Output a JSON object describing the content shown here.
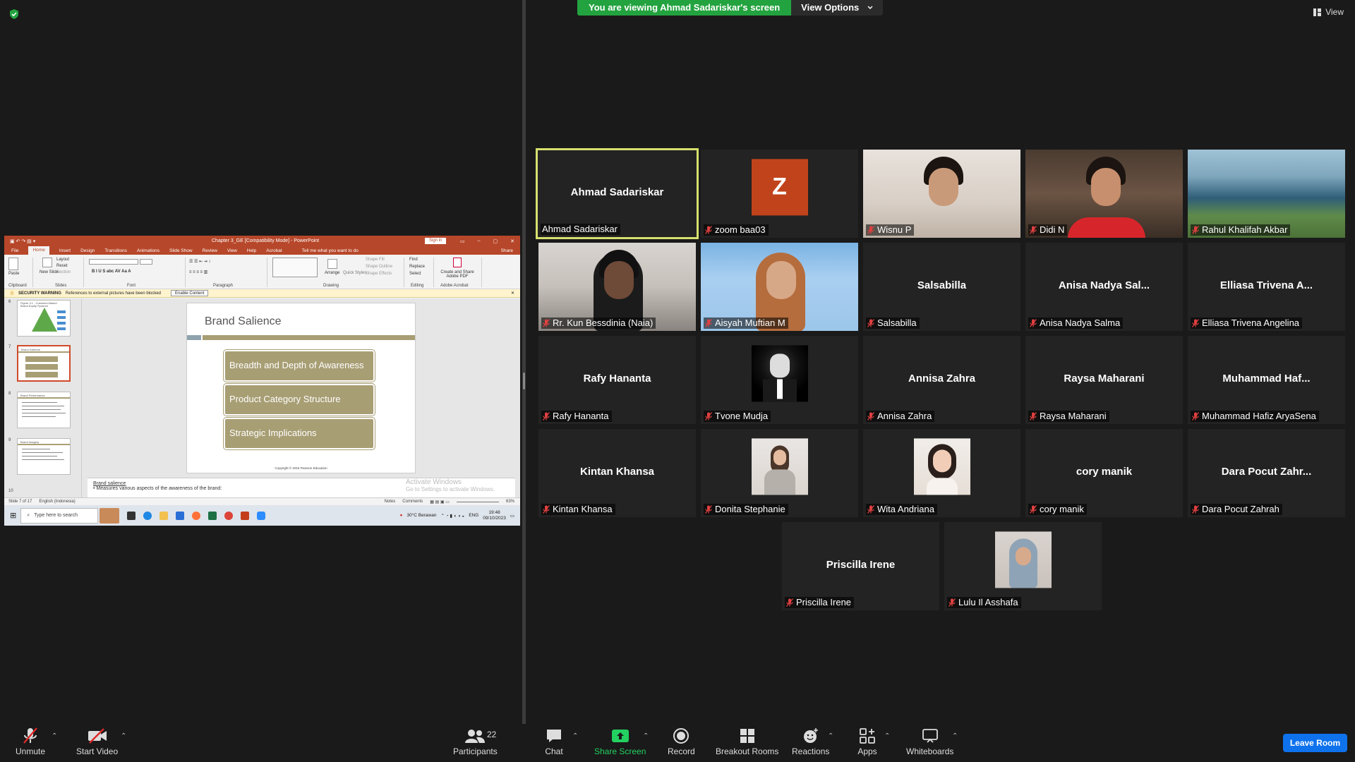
{
  "banner": {
    "viewing_text": "You are viewing Ahmad Sadariskar's screen",
    "view_options": "View Options"
  },
  "top_right": {
    "view_label": "View"
  },
  "ppt": {
    "window_title": "Chapter 3_GE [Compatibility Mode] - PowerPoint",
    "sign_in": "Sign in",
    "tabs": [
      "File",
      "Home",
      "Insert",
      "Design",
      "Transitions",
      "Animations",
      "Slide Show",
      "Review",
      "View",
      "Help",
      "Acrobat"
    ],
    "tell_me": "Tell me what you want to do",
    "share": "Share",
    "ribbon_groups": [
      "Clipboard",
      "Slides",
      "Font",
      "Paragraph",
      "Drawing",
      "Editing",
      "Adobe Acrobat"
    ],
    "ribbon_items": {
      "paste": "Paste",
      "new_slide": "New Slide",
      "layout": "Layout",
      "reset": "Reset",
      "section": "Section",
      "arrange": "Arrange",
      "quick_styles": "Quick Styles",
      "shape_fill": "Shape Fill",
      "shape_outline": "Shape Outline",
      "shape_effects": "Shape Effects",
      "find": "Find",
      "replace": "Replace",
      "select": "Select",
      "create_share": "Create and Share Adobe PDF"
    },
    "warning_title": "SECURITY WARNING",
    "warning_text": "References to external pictures have been blocked",
    "enable_content": "Enable Content",
    "thumbnails": [
      {
        "num": "6",
        "title": "Figure 3.1 - Customer-Based Brand Equity Pyramid"
      },
      {
        "num": "7",
        "title": "Brand Salience"
      },
      {
        "num": "8",
        "title": "Brand Performance"
      },
      {
        "num": "9",
        "title": "Brand Imagery"
      },
      {
        "num": "10",
        "title": ""
      }
    ],
    "slide": {
      "title": "Brand Salience",
      "boxes": [
        "Breadth and Depth of Awareness",
        "Product Category Structure",
        "Strategic Implications"
      ],
      "footer": "Copyright © 2015 Pearson Education"
    },
    "notes_title": "Brand salience",
    "notes_bullet": "Measures various aspects of the awareness of the brand:",
    "status_slide": "Slide 7 of 17",
    "status_lang": "English (Indonesia)",
    "status_notes": "Notes",
    "status_comments": "Comments",
    "status_zoom": "63%",
    "activate_title": "Activate Windows",
    "activate_sub": "Go to Settings to activate Windows.",
    "taskbar_search": "Type here to search",
    "weather": "30°C  Berawan",
    "lang": "ENG",
    "time": "19:48",
    "date": "09/10/2023"
  },
  "participants": [
    {
      "name": "Ahmad Sadariskar",
      "label": "Ahmad Sadariskar",
      "type": "name",
      "active": true,
      "muted": false
    },
    {
      "name": "Z",
      "label": "zoom baa03",
      "type": "initial",
      "active": false,
      "muted": true
    },
    {
      "name": "Wisnu P",
      "label": "Wisnu P",
      "type": "video",
      "active": false,
      "muted": true
    },
    {
      "name": "Didi N",
      "label": "Didi N",
      "type": "video",
      "active": false,
      "muted": true
    },
    {
      "name": "Rahul Khalifah Akbar",
      "label": "Rahul Khalifah Akbar",
      "type": "video",
      "active": false,
      "muted": true
    },
    {
      "name": "Rr. Kun Bessdinia (Naia)",
      "label": "Rr. Kun Bessdinia (Naia)",
      "type": "video",
      "active": false,
      "muted": true
    },
    {
      "name": "Aisyah Muftian M",
      "label": "Aisyah Muftian M",
      "type": "video",
      "active": false,
      "muted": true
    },
    {
      "name": "Salsabilla",
      "label": "Salsabilla",
      "type": "name",
      "active": false,
      "muted": true
    },
    {
      "name": "Anisa Nadya Sal...",
      "label": "Anisa Nadya Salma",
      "type": "name",
      "active": false,
      "muted": true
    },
    {
      "name": "Elliasa Trivena A...",
      "label": "Elliasa Trivena Angelina",
      "type": "name",
      "active": false,
      "muted": true
    },
    {
      "name": "Rafy Hananta",
      "label": "Rafy Hananta",
      "type": "name",
      "active": false,
      "muted": true
    },
    {
      "name": "Tvone Mudja",
      "label": "Tvone Mudja",
      "type": "avatar",
      "active": false,
      "muted": true
    },
    {
      "name": "Annisa Zahra",
      "label": "Annisa Zahra",
      "type": "name",
      "active": false,
      "muted": true
    },
    {
      "name": "Raysa Maharani",
      "label": "Raysa Maharani",
      "type": "name",
      "active": false,
      "muted": true
    },
    {
      "name": "Muhammad Haf...",
      "label": "Muhammad Hafiz AryaSena",
      "type": "name",
      "active": false,
      "muted": true
    },
    {
      "name": "Kintan Khansa",
      "label": "Kintan Khansa",
      "type": "name",
      "active": false,
      "muted": true
    },
    {
      "name": "Donita Stephanie",
      "label": "Donita Stephanie",
      "type": "avatar",
      "active": false,
      "muted": true
    },
    {
      "name": "Wita Andriana",
      "label": "Wita Andriana",
      "type": "avatar",
      "active": false,
      "muted": true
    },
    {
      "name": "cory manik",
      "label": "cory manik",
      "type": "name",
      "active": false,
      "muted": true
    },
    {
      "name": "Dara Pocut Zahr...",
      "label": "Dara Pocut Zahrah",
      "type": "name",
      "active": false,
      "muted": true
    },
    {
      "name": "Priscilla Irene",
      "label": "Priscilla Irene",
      "type": "name",
      "active": false,
      "muted": true
    },
    {
      "name": "Lulu Il Asshafa",
      "label": "Lulu Il Asshafa",
      "type": "avatar",
      "active": false,
      "muted": true
    }
  ],
  "toolbar": {
    "unmute": "Unmute",
    "start_video": "Start Video",
    "participants": "Participants",
    "participants_count": "22",
    "chat": "Chat",
    "share_screen": "Share Screen",
    "record": "Record",
    "breakout_rooms": "Breakout Rooms",
    "reactions": "Reactions",
    "apps": "Apps",
    "whiteboards": "Whiteboards",
    "leave_room": "Leave Room"
  },
  "colors": {
    "green": "#23a33f",
    "active_border": "#d6e06e",
    "leave_blue": "#0e72ed",
    "ppt_red": "#b7472a",
    "slide_khaki": "#a89e74",
    "initial_bg": "#c1431b"
  }
}
